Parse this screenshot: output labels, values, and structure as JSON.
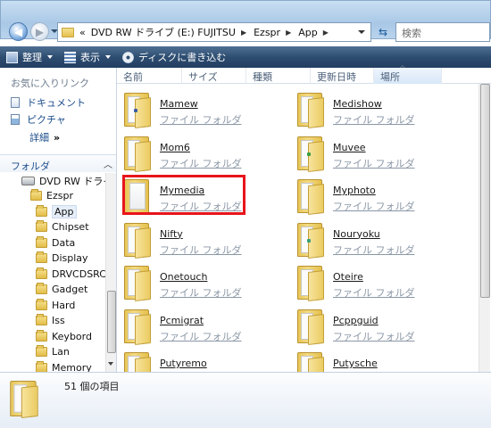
{
  "address": {
    "overflow": "«",
    "segments": [
      "DVD RW ドライブ (E:) FUJITSU",
      "Ezspr",
      "App"
    ],
    "search_placeholder": "検索"
  },
  "toolbar": {
    "organize": "整理",
    "views": "表示",
    "burn": "ディスクに書き込む"
  },
  "favorites": {
    "title": "お気に入りリンク",
    "items": [
      "ドキュメント",
      "ピクチャ"
    ],
    "more": "詳細",
    "more_chevron": "»"
  },
  "folders_header": {
    "label": "フォルダ",
    "chevron": "︿"
  },
  "tree": [
    {
      "label": "DVD RW ドライブ",
      "kind": "drive"
    },
    {
      "label": "Ezspr",
      "kind": "folder"
    },
    {
      "label": "App",
      "kind": "folder",
      "selected": true
    },
    {
      "label": "Chipset",
      "kind": "folder"
    },
    {
      "label": "Data",
      "kind": "folder"
    },
    {
      "label": "Display",
      "kind": "folder"
    },
    {
      "label": "DRVCDSRC",
      "kind": "folder"
    },
    {
      "label": "Gadget",
      "kind": "folder"
    },
    {
      "label": "Hard",
      "kind": "folder"
    },
    {
      "label": "Iss",
      "kind": "folder"
    },
    {
      "label": "Keybord",
      "kind": "folder"
    },
    {
      "label": "Lan",
      "kind": "folder"
    },
    {
      "label": "Memory",
      "kind": "folder"
    }
  ],
  "columns": [
    "名前",
    "サイズ",
    "種類",
    "更新日時",
    "場所"
  ],
  "sort_arrow": "^",
  "folder_type_label": "ファイル フォルダ",
  "items": [
    {
      "name": "Mamew",
      "badge": "#3b5fa0"
    },
    {
      "name": "Medishow",
      "badge": ""
    },
    {
      "name": "Mom6",
      "badge": ""
    },
    {
      "name": "Muvee",
      "badge": "#3aa043"
    },
    {
      "name": "Mymedia",
      "badge": "",
      "plain": true
    },
    {
      "name": "Myphoto",
      "badge": ""
    },
    {
      "name": "Nifty",
      "badge": ""
    },
    {
      "name": "Nouryoku",
      "badge": "#3aa07a"
    },
    {
      "name": "Onetouch",
      "badge": ""
    },
    {
      "name": "Oteire",
      "badge": ""
    },
    {
      "name": "Pcmigrat",
      "badge": ""
    },
    {
      "name": "Pcppguid",
      "badge": ""
    },
    {
      "name": "Putyremo",
      "badge": ""
    },
    {
      "name": "Putysche",
      "badge": ""
    }
  ],
  "status": {
    "count_text": "51 個の項目"
  },
  "colors": {
    "highlight": "#e8141b",
    "command_bar": "#2d4d71",
    "link": "#1c4d8c"
  }
}
